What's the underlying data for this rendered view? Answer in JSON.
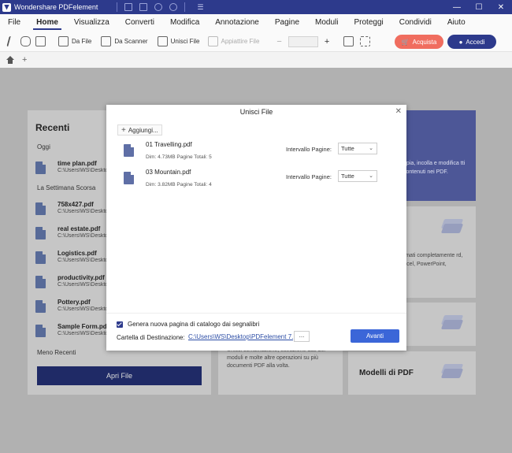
{
  "window": {
    "app_title": "Wondershare PDFelement",
    "minimize": "—",
    "maximize": "☐",
    "close": "✕",
    "quick_menu": "☰"
  },
  "menu": {
    "items": [
      "File",
      "Home",
      "Visualizza",
      "Converti",
      "Modifica",
      "Annotazione",
      "Pagine",
      "Moduli",
      "Proteggi",
      "Condividi",
      "Aiuto"
    ],
    "active": "Home"
  },
  "toolbar": {
    "da_file": "Da File",
    "da_scanner": "Da Scanner",
    "unisci_file": "Unisci File",
    "appiattire_file": "Appiattire File",
    "zoom_minus": "−",
    "zoom_plus": "+",
    "buy_label": "Acquista",
    "login_label": "Accedi",
    "buy_color": "#f06d5f",
    "brand_color": "#2d3a8c"
  },
  "tabstrip": {
    "add_tab": "+"
  },
  "recent": {
    "title": "Recenti",
    "today_label": "Oggi",
    "week_label": "La Settimana Scorsa",
    "less_recent_label": "Meno Recenti",
    "files": [
      {
        "name": "time plan.pdf",
        "path": "C:\\Users\\WS\\Desktop"
      },
      {
        "name": "758x427.pdf",
        "path": "C:\\Users\\WS\\Desktop"
      },
      {
        "name": "real estate.pdf",
        "path": "C:\\Users\\WS\\Desktop"
      },
      {
        "name": "Logistics.pdf",
        "path": "C:\\Users\\WS\\Desktop"
      },
      {
        "name": "productivity.pdf",
        "path": "C:\\Users\\WS\\Desktop"
      },
      {
        "name": "Pottery.pdf",
        "path": "C:\\Users\\WS\\Desktop"
      },
      {
        "name": "Sample Form.pdf",
        "path": "C:\\Users\\WS\\Desktop"
      }
    ],
    "open_button": "Apri File"
  },
  "cards": {
    "promo_text": "opia, incolla e modifica tti contenuti nei PDF.",
    "convert_title": "e",
    "convert_text": "ormati completamente rd, Excel, PowerPoint,",
    "combine_text": "Unisci combinazione, estrazione dati dei moduli e molte altre operazioni su più documenti PDF alla volta.",
    "templates_title": "Modelli di PDF"
  },
  "modal": {
    "title": "Unisci File",
    "close": "✕",
    "add_button": "Aggiungi...",
    "files": [
      {
        "name": "01 Travelling.pdf",
        "size": "Dim: 4.73MB   Pagine Totali: 5",
        "range_label": "Intervallo Pagine:",
        "range_value": "Tutte"
      },
      {
        "name": "03 Mountain.pdf",
        "size": "Dim: 3.82MB   Pagine Totali: 4",
        "range_label": "Intervallo Pagine:",
        "range_value": "Tutte"
      }
    ],
    "catalog_label": "Genera nuova pagina di catalogo dai segnalibri",
    "dest_label": "Cartella di Destinazione:",
    "dest_path": "C:\\Users\\WS\\Desktop\\PDFelement 7...",
    "dest_more": "...",
    "next_button": "Avanti",
    "next_color": "#3b66d8"
  }
}
